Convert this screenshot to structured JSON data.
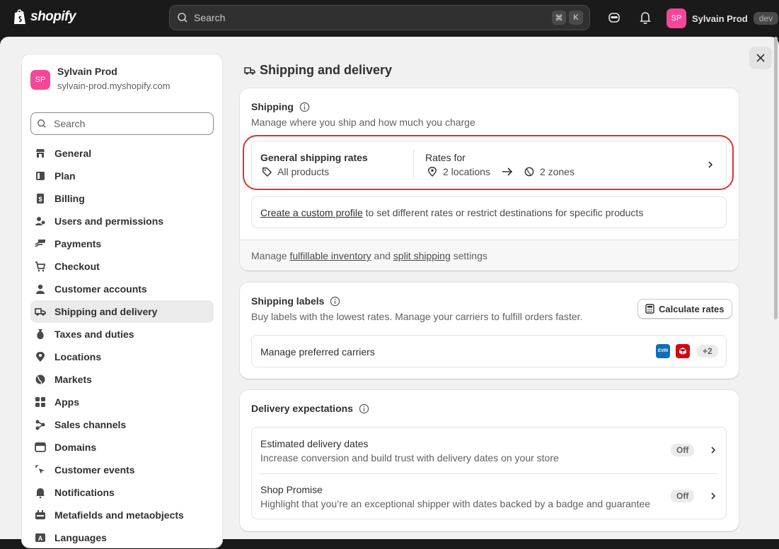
{
  "topbar": {
    "logo": "shopify",
    "search_placeholder": "Search",
    "shortcut_cmd": "⌘",
    "shortcut_key": "K",
    "store_initials": "SP",
    "store_name": "Sylvain Prod",
    "env_badge": "dev"
  },
  "sidebar": {
    "store_initials": "SP",
    "store_title": "Sylvain Prod",
    "store_domain": "sylvain-prod.myshopify.com",
    "search_placeholder": "Search",
    "items": [
      {
        "label": "General",
        "icon": "store-icon"
      },
      {
        "label": "Plan",
        "icon": "plan-icon"
      },
      {
        "label": "Billing",
        "icon": "billing-icon"
      },
      {
        "label": "Users and permissions",
        "icon": "users-icon"
      },
      {
        "label": "Payments",
        "icon": "payments-icon"
      },
      {
        "label": "Checkout",
        "icon": "cart-icon"
      },
      {
        "label": "Customer accounts",
        "icon": "person-icon"
      },
      {
        "label": "Shipping and delivery",
        "icon": "truck-icon",
        "active": true
      },
      {
        "label": "Taxes and duties",
        "icon": "tax-icon"
      },
      {
        "label": "Locations",
        "icon": "location-icon"
      },
      {
        "label": "Markets",
        "icon": "globe-icon"
      },
      {
        "label": "Apps",
        "icon": "apps-icon"
      },
      {
        "label": "Sales channels",
        "icon": "channels-icon"
      },
      {
        "label": "Domains",
        "icon": "domains-icon"
      },
      {
        "label": "Customer events",
        "icon": "cursor-icon"
      },
      {
        "label": "Notifications",
        "icon": "bell-icon"
      },
      {
        "label": "Metafields and metaobjects",
        "icon": "metafields-icon"
      },
      {
        "label": "Languages",
        "icon": "languages-icon"
      }
    ]
  },
  "page": {
    "title": "Shipping and delivery"
  },
  "shipping": {
    "heading": "Shipping",
    "subtitle": "Manage where you ship and how much you charge",
    "rates_title": "General shipping rates",
    "rates_products": "All products",
    "rates_for": "Rates for",
    "locations": "2 locations",
    "zones": "2 zones",
    "custom_profile_link": "Create a custom profile",
    "custom_profile_rest": "to set different rates or restrict destinations for specific products",
    "footer_manage": "Manage",
    "footer_inventory_link": "fulfillable inventory",
    "footer_and": "and",
    "footer_split_link": "split shipping",
    "footer_settings": "settings"
  },
  "labels": {
    "heading": "Shipping labels",
    "subtitle": "Buy labels with the lowest rates. Manage your carriers to fulfill orders faster.",
    "calc_button": "Calculate rates",
    "carriers_label": "Manage preferred carriers",
    "carrier1": "EVRI",
    "carriers_more": "+2"
  },
  "delivery": {
    "heading": "Delivery expectations",
    "rows": [
      {
        "title": "Estimated delivery dates",
        "desc": "Increase conversion and build trust with delivery dates on your store",
        "status": "Off"
      },
      {
        "title": "Shop Promise",
        "desc": "Highlight that you’re an exceptional shipper with dates backed by a badge and guarantee",
        "status": "Off"
      }
    ]
  }
}
